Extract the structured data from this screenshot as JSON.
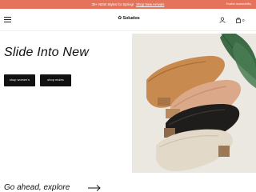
{
  "promo": {
    "text": "30+ NEW Styles for Spring!",
    "link": "Shop New Arrivals",
    "right_text": "Enable accessibility",
    "background": "#e5735c"
  },
  "header": {
    "logo_mark": "✿",
    "logo_text": "Soludos",
    "cart_count": "0",
    "icons": [
      "search-icon",
      "menu-icon",
      "user-icon",
      "shopping-bag-icon"
    ]
  },
  "hero": {
    "title": "Slide Into New",
    "buttons": {
      "women": "shop women's",
      "mules": "shop mules"
    },
    "image_subject": "stack of leather mules"
  },
  "explore": {
    "text": "Go ahead, explore"
  }
}
